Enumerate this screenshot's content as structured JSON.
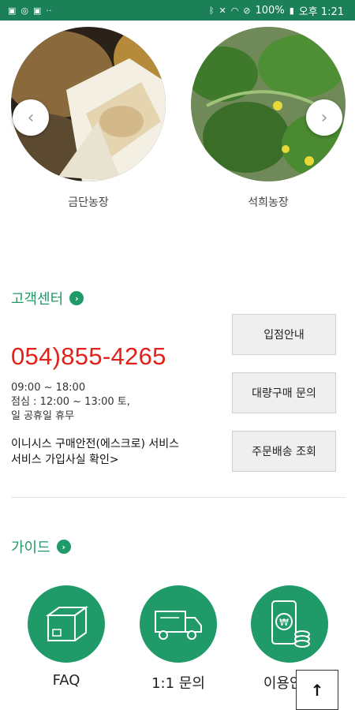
{
  "status_bar": {
    "left_icons": [
      "gallery-icon",
      "whatsapp-icon",
      "photo-icon",
      "more-dots-icon"
    ],
    "right_icons": [
      "bluetooth-icon",
      "mute-icon",
      "wifi-icon",
      "no-data-icon"
    ],
    "battery": "100%",
    "time": "오후 1:21"
  },
  "farms": [
    {
      "name": "금단농장",
      "image": "melon-photo"
    },
    {
      "name": "석희농장",
      "image": "cucumber-plant-photo"
    }
  ],
  "carousel": {
    "prev_icon": "chevron-left-icon",
    "next_icon": "chevron-right-icon"
  },
  "customer_center": {
    "title": "고객센터",
    "phone": "054)855-4265",
    "hours_line1": "09:00 ~ 18:00",
    "hours_line2": "점심 : 12:00 ~ 13:00 토,",
    "hours_line3": "일 공휴일 휴무",
    "escrow_line1": "이니시스 구매안전(에스크로) 서비스",
    "escrow_line2": "서비스 가입사실 확인>",
    "buttons": [
      "입점안내",
      "대량구매 문의",
      "주문배송 조회"
    ]
  },
  "guide": {
    "title": "가이드",
    "items": [
      {
        "label": "FAQ",
        "icon": "box-icon"
      },
      {
        "label": "1:1 문의",
        "icon": "truck-icon"
      },
      {
        "label": "이용안내",
        "icon": "phone-coin-icon"
      }
    ]
  },
  "top_button_icon": "arrow-up-icon",
  "colors": {
    "brand_green": "#1f9a68",
    "status_bar": "#1b7f58",
    "phone_red": "#e0221a"
  }
}
